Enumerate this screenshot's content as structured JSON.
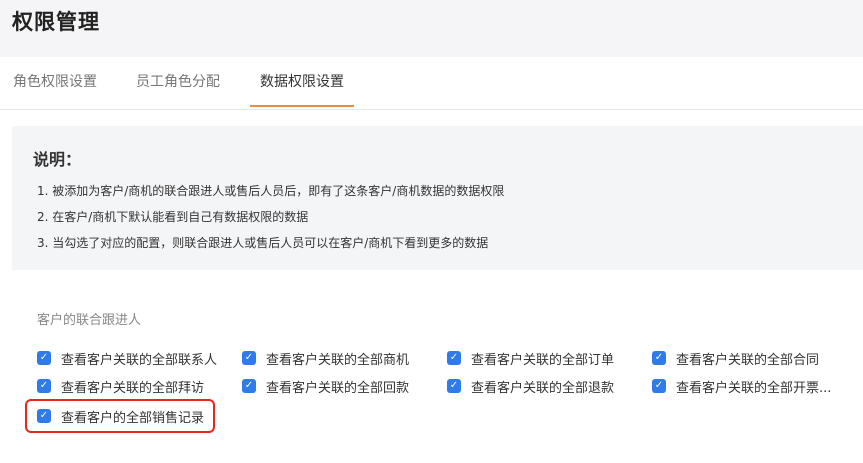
{
  "header": {
    "title": "权限管理"
  },
  "tabs": [
    {
      "label": "角色权限设置"
    },
    {
      "label": "员工角色分配"
    },
    {
      "label": "数据权限设置"
    }
  ],
  "notice": {
    "title": "说明：",
    "lines": [
      "1. 被添加为客户/商机的联合跟进人或售后人员后，即有了这条客户/商机数据的数据权限",
      "2. 在客户/商机下默认能看到自己有数据权限的数据",
      "3. 当勾选了对应的配置，则联合跟进人或售后人员可以在客户/商机下看到更多的数据"
    ]
  },
  "section": {
    "label": "客户的联合跟进人",
    "options": [
      {
        "label": "查看客户关联的全部联系人",
        "checked": true
      },
      {
        "label": "查看客户关联的全部商机",
        "checked": true
      },
      {
        "label": "查看客户关联的全部订单",
        "checked": true
      },
      {
        "label": "查看客户关联的全部合同",
        "checked": true
      },
      {
        "label": "查看客户关联的全部拜访",
        "checked": true
      },
      {
        "label": "查看客户关联的全部回款",
        "checked": true
      },
      {
        "label": "查看客户关联的全部退款",
        "checked": true
      },
      {
        "label": "查看客户关联的全部开票...",
        "checked": true
      },
      {
        "label": "查看客户的全部销售记录",
        "checked": true
      }
    ]
  },
  "colors": {
    "accent": "#f08a3c",
    "checkbox": "#2f7bea",
    "highlight": "#e5281f"
  }
}
